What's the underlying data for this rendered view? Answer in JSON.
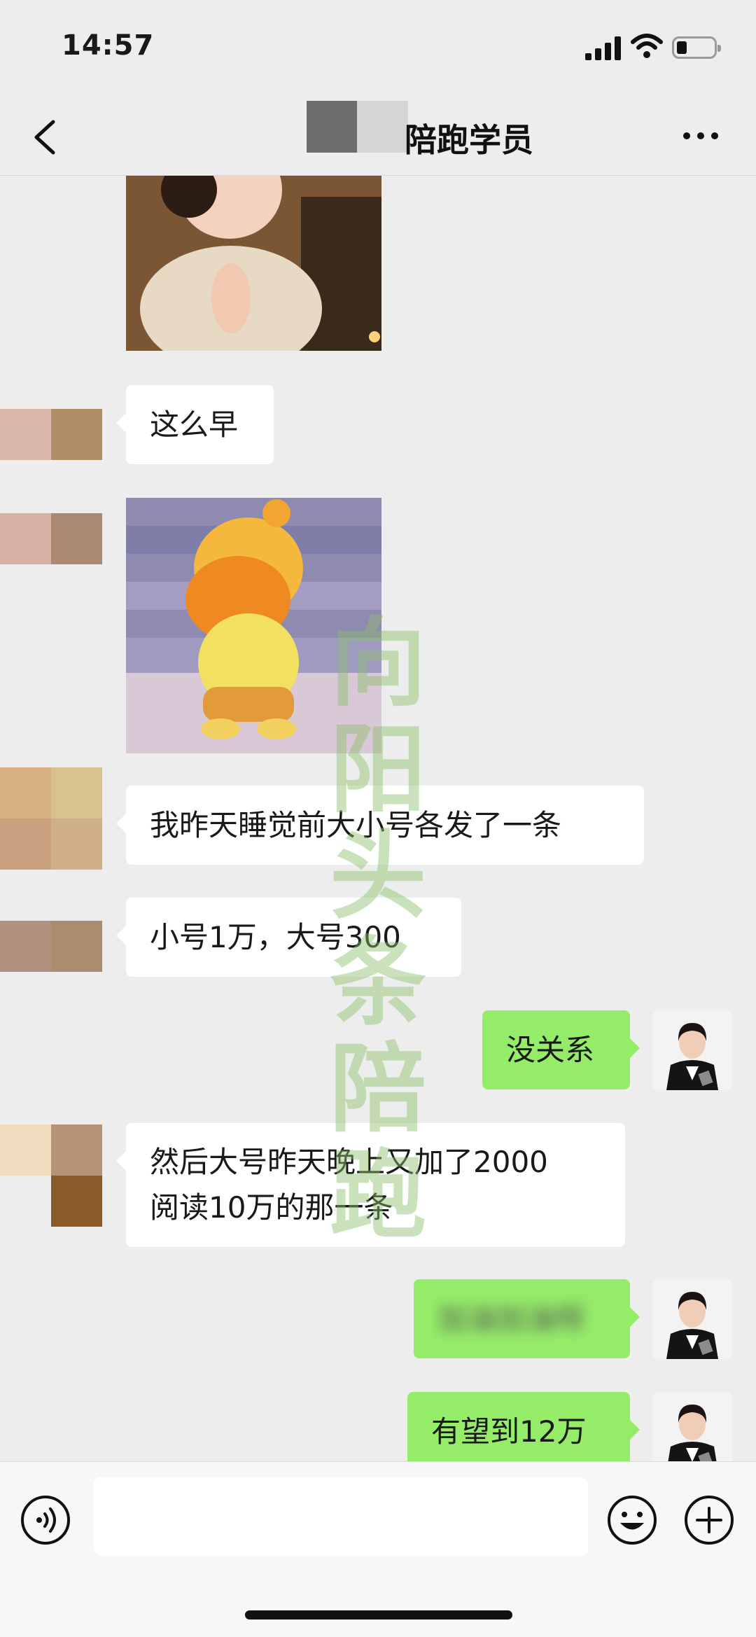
{
  "status_bar": {
    "time": "14:57"
  },
  "header": {
    "title": "陪跑学员"
  },
  "messages": [
    {
      "side": "in",
      "type": "sticker",
      "sticker": "baby-clapping"
    },
    {
      "side": "in",
      "type": "text",
      "text": "这么早"
    },
    {
      "side": "in",
      "type": "sticker",
      "sticker": "yellow-cartoon-dancing"
    },
    {
      "side": "in",
      "type": "text",
      "text": "我昨天睡觉前大小号各发了一条"
    },
    {
      "side": "in",
      "type": "text",
      "text": "小号1万，大号300"
    },
    {
      "side": "out",
      "type": "text",
      "text": "没关系"
    },
    {
      "side": "in",
      "type": "text",
      "line1": "然后大号昨天晚上又加了2000",
      "line2": "阅读10万的那一条"
    },
    {
      "side": "out",
      "type": "text",
      "blurred": true,
      "text": "加油加油呀"
    },
    {
      "side": "out",
      "type": "text",
      "text": "有望到12万"
    }
  ],
  "watermark": {
    "chars": [
      "向",
      "阳",
      "头",
      "条",
      "陪",
      "跑"
    ]
  },
  "icons": {
    "back": "chevron-left-icon",
    "more": "more-dots-icon",
    "voice": "voice-icon",
    "emoji": "emoji-icon",
    "plus": "plus-icon"
  },
  "colors": {
    "background": "#ededed",
    "incoming_bubble": "#ffffff",
    "outgoing_bubble": "#95ec69",
    "watermark": "#8cc16a"
  }
}
